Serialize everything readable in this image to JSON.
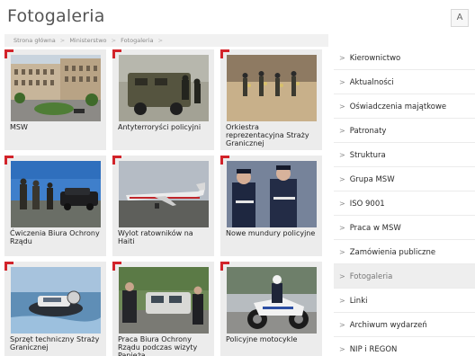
{
  "header": {
    "title": "Fotogaleria",
    "font_button": "A"
  },
  "breadcrumb": [
    "Strona główna",
    "Ministerstwo",
    "Fotogaleria"
  ],
  "gallery": [
    {
      "caption": "MSW",
      "image": "building-photo"
    },
    {
      "caption": "Antyterroryści policyjni",
      "image": "armored-vehicle-photo"
    },
    {
      "caption": "Orkiestra reprezentacyjna Straży Granicznej",
      "image": "marching-band-photo"
    },
    {
      "caption": "Ćwiczenia Biura Ochrony Rządu",
      "image": "security-drill-photo"
    },
    {
      "caption": "Wylot ratowników na Haiti",
      "image": "airplane-photo"
    },
    {
      "caption": "Nowe mundury policyjne",
      "image": "police-uniforms-photo"
    },
    {
      "caption": "Sprzęt techniczny Straży Granicznej",
      "image": "hovercraft-photo"
    },
    {
      "caption": "Praca Biura Ochrony Rządu podczas wizyty Papieża",
      "image": "papal-visit-photo"
    },
    {
      "caption": "Policyjne motocykle",
      "image": "police-motorcycle-photo"
    }
  ],
  "sidebar": {
    "items": [
      {
        "label": "Kierownictwo",
        "active": false
      },
      {
        "label": "Aktualności",
        "active": false
      },
      {
        "label": "Oświadczenia majątkowe",
        "active": false
      },
      {
        "label": "Patronaty",
        "active": false
      },
      {
        "label": "Struktura",
        "active": false
      },
      {
        "label": "Grupa MSW",
        "active": false
      },
      {
        "label": "ISO 9001",
        "active": false
      },
      {
        "label": "Praca w MSW",
        "active": false
      },
      {
        "label": "Zamówienia publiczne",
        "active": false
      },
      {
        "label": "Fotogaleria",
        "active": true
      },
      {
        "label": "Linki",
        "active": false
      },
      {
        "label": "Archiwum wydarzeń",
        "active": false
      },
      {
        "label": "NIP i REGON",
        "active": false
      }
    ]
  },
  "colors": {
    "accent": "#d2232a",
    "tile_bg": "#ececec",
    "active_bg": "#eeeeee"
  }
}
